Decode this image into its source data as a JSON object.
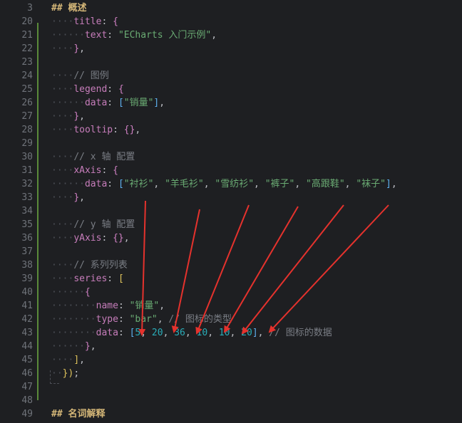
{
  "editor": {
    "lines": [
      {
        "n": "3",
        "tokens": [
          {
            "t": "## 概述",
            "c": "k-head"
          }
        ]
      },
      {
        "n": "20",
        "tokens": [
          {
            "t": "····",
            "c": "dot"
          },
          {
            "t": "title",
            "c": "k-prop"
          },
          {
            "t": ": ",
            "c": "k-p"
          },
          {
            "t": "{",
            "c": "k-b2"
          }
        ]
      },
      {
        "n": "21",
        "tokens": [
          {
            "t": "······",
            "c": "dot"
          },
          {
            "t": "text",
            "c": "k-prop"
          },
          {
            "t": ": ",
            "c": "k-p"
          },
          {
            "t": "\"ECharts 入门示例\"",
            "c": "k-str"
          },
          {
            "t": ",",
            "c": "k-p"
          }
        ]
      },
      {
        "n": "22",
        "tokens": [
          {
            "t": "····",
            "c": "dot"
          },
          {
            "t": "}",
            "c": "k-b2"
          },
          {
            "t": ",",
            "c": "k-p"
          }
        ]
      },
      {
        "n": "23",
        "tokens": []
      },
      {
        "n": "24",
        "tokens": [
          {
            "t": "····",
            "c": "dot"
          },
          {
            "t": "// 图例",
            "c": "k-com"
          }
        ]
      },
      {
        "n": "25",
        "tokens": [
          {
            "t": "····",
            "c": "dot"
          },
          {
            "t": "legend",
            "c": "k-prop"
          },
          {
            "t": ": ",
            "c": "k-p"
          },
          {
            "t": "{",
            "c": "k-b2"
          }
        ]
      },
      {
        "n": "26",
        "tokens": [
          {
            "t": "······",
            "c": "dot"
          },
          {
            "t": "data",
            "c": "k-prop"
          },
          {
            "t": ": ",
            "c": "k-p"
          },
          {
            "t": "[",
            "c": "k-b3"
          },
          {
            "t": "\"销量\"",
            "c": "k-str"
          },
          {
            "t": "]",
            "c": "k-b3"
          },
          {
            "t": ",",
            "c": "k-p"
          }
        ]
      },
      {
        "n": "27",
        "tokens": [
          {
            "t": "····",
            "c": "dot"
          },
          {
            "t": "}",
            "c": "k-b2"
          },
          {
            "t": ",",
            "c": "k-p"
          }
        ]
      },
      {
        "n": "28",
        "tokens": [
          {
            "t": "····",
            "c": "dot"
          },
          {
            "t": "tooltip",
            "c": "k-prop"
          },
          {
            "t": ": ",
            "c": "k-p"
          },
          {
            "t": "{}",
            "c": "k-b2"
          },
          {
            "t": ",",
            "c": "k-p"
          }
        ]
      },
      {
        "n": "29",
        "tokens": []
      },
      {
        "n": "30",
        "tokens": [
          {
            "t": "····",
            "c": "dot"
          },
          {
            "t": "// x 轴 配置",
            "c": "k-com"
          }
        ]
      },
      {
        "n": "31",
        "tokens": [
          {
            "t": "····",
            "c": "dot"
          },
          {
            "t": "xAxis",
            "c": "k-prop"
          },
          {
            "t": ": ",
            "c": "k-p"
          },
          {
            "t": "{",
            "c": "k-b2"
          }
        ]
      },
      {
        "n": "32",
        "tokens": [
          {
            "t": "······",
            "c": "dot"
          },
          {
            "t": "data",
            "c": "k-prop"
          },
          {
            "t": ": ",
            "c": "k-p"
          },
          {
            "t": "[",
            "c": "k-b3"
          },
          {
            "t": "\"衬衫\"",
            "c": "k-str"
          },
          {
            "t": ", ",
            "c": "k-p"
          },
          {
            "t": "\"羊毛衫\"",
            "c": "k-str"
          },
          {
            "t": ", ",
            "c": "k-p"
          },
          {
            "t": "\"雪纺衫\"",
            "c": "k-str"
          },
          {
            "t": ", ",
            "c": "k-p"
          },
          {
            "t": "\"裤子\"",
            "c": "k-str"
          },
          {
            "t": ", ",
            "c": "k-p"
          },
          {
            "t": "\"高跟鞋\"",
            "c": "k-str"
          },
          {
            "t": ", ",
            "c": "k-p"
          },
          {
            "t": "\"袜子\"",
            "c": "k-str"
          },
          {
            "t": "]",
            "c": "k-b3"
          },
          {
            "t": ",",
            "c": "k-p"
          }
        ]
      },
      {
        "n": "33",
        "tokens": [
          {
            "t": "····",
            "c": "dot"
          },
          {
            "t": "}",
            "c": "k-b2"
          },
          {
            "t": ",",
            "c": "k-p"
          }
        ]
      },
      {
        "n": "34",
        "tokens": []
      },
      {
        "n": "35",
        "tokens": [
          {
            "t": "····",
            "c": "dot"
          },
          {
            "t": "// y 轴 配置",
            "c": "k-com"
          }
        ]
      },
      {
        "n": "36",
        "tokens": [
          {
            "t": "····",
            "c": "dot"
          },
          {
            "t": "yAxis",
            "c": "k-prop"
          },
          {
            "t": ": ",
            "c": "k-p"
          },
          {
            "t": "{}",
            "c": "k-b2"
          },
          {
            "t": ",",
            "c": "k-p"
          }
        ]
      },
      {
        "n": "37",
        "tokens": []
      },
      {
        "n": "38",
        "tokens": [
          {
            "t": "····",
            "c": "dot"
          },
          {
            "t": "// 系列列表",
            "c": "k-com"
          }
        ]
      },
      {
        "n": "39",
        "tokens": [
          {
            "t": "····",
            "c": "dot"
          },
          {
            "t": "series",
            "c": "k-prop"
          },
          {
            "t": ": ",
            "c": "k-p"
          },
          {
            "t": "[",
            "c": "k-b1"
          }
        ]
      },
      {
        "n": "40",
        "tokens": [
          {
            "t": "······",
            "c": "dot"
          },
          {
            "t": "{",
            "c": "k-b2"
          }
        ]
      },
      {
        "n": "41",
        "tokens": [
          {
            "t": "········",
            "c": "dot"
          },
          {
            "t": "name",
            "c": "k-prop"
          },
          {
            "t": ": ",
            "c": "k-p"
          },
          {
            "t": "\"销量\"",
            "c": "k-str"
          },
          {
            "t": ",",
            "c": "k-p"
          }
        ]
      },
      {
        "n": "42",
        "tokens": [
          {
            "t": "········",
            "c": "dot"
          },
          {
            "t": "type",
            "c": "k-prop"
          },
          {
            "t": ": ",
            "c": "k-p"
          },
          {
            "t": "\"bar\"",
            "c": "k-str"
          },
          {
            "t": ", ",
            "c": "k-p"
          },
          {
            "t": "// 图标的类型",
            "c": "k-com"
          }
        ]
      },
      {
        "n": "43",
        "tokens": [
          {
            "t": "········",
            "c": "dot"
          },
          {
            "t": "data",
            "c": "k-prop"
          },
          {
            "t": ": ",
            "c": "k-p"
          },
          {
            "t": "[",
            "c": "k-b3"
          },
          {
            "t": "5",
            "c": "k-num"
          },
          {
            "t": ", ",
            "c": "k-p"
          },
          {
            "t": "20",
            "c": "k-num"
          },
          {
            "t": ", ",
            "c": "k-p"
          },
          {
            "t": "36",
            "c": "k-num"
          },
          {
            "t": ", ",
            "c": "k-p"
          },
          {
            "t": "10",
            "c": "k-num"
          },
          {
            "t": ", ",
            "c": "k-p"
          },
          {
            "t": "10",
            "c": "k-num"
          },
          {
            "t": ", ",
            "c": "k-p"
          },
          {
            "t": "20",
            "c": "k-num"
          },
          {
            "t": "]",
            "c": "k-b3"
          },
          {
            "t": ", ",
            "c": "k-p"
          },
          {
            "t": "// 图标的数据",
            "c": "k-com"
          }
        ]
      },
      {
        "n": "44",
        "tokens": [
          {
            "t": "······",
            "c": "dot"
          },
          {
            "t": "}",
            "c": "k-b2"
          },
          {
            "t": ",",
            "c": "k-p"
          }
        ]
      },
      {
        "n": "45",
        "tokens": [
          {
            "t": "····",
            "c": "dot"
          },
          {
            "t": "]",
            "c": "k-b1"
          },
          {
            "t": ",",
            "c": "k-p"
          }
        ]
      },
      {
        "n": "46",
        "tokens": [
          {
            "t": "··",
            "c": "dot"
          },
          {
            "t": "})",
            "c": "k-b1"
          },
          {
            "t": ";",
            "c": "k-p"
          }
        ]
      },
      {
        "n": "47",
        "tokens": []
      },
      {
        "n": "48",
        "tokens": []
      },
      {
        "n": "49",
        "tokens": [
          {
            "t": "## 名词解释",
            "c": "k-head"
          }
        ]
      }
    ]
  },
  "colors": {
    "arrow": "#e5322d",
    "background": "#1e1f22",
    "change_bar": "#5a8a3a"
  }
}
